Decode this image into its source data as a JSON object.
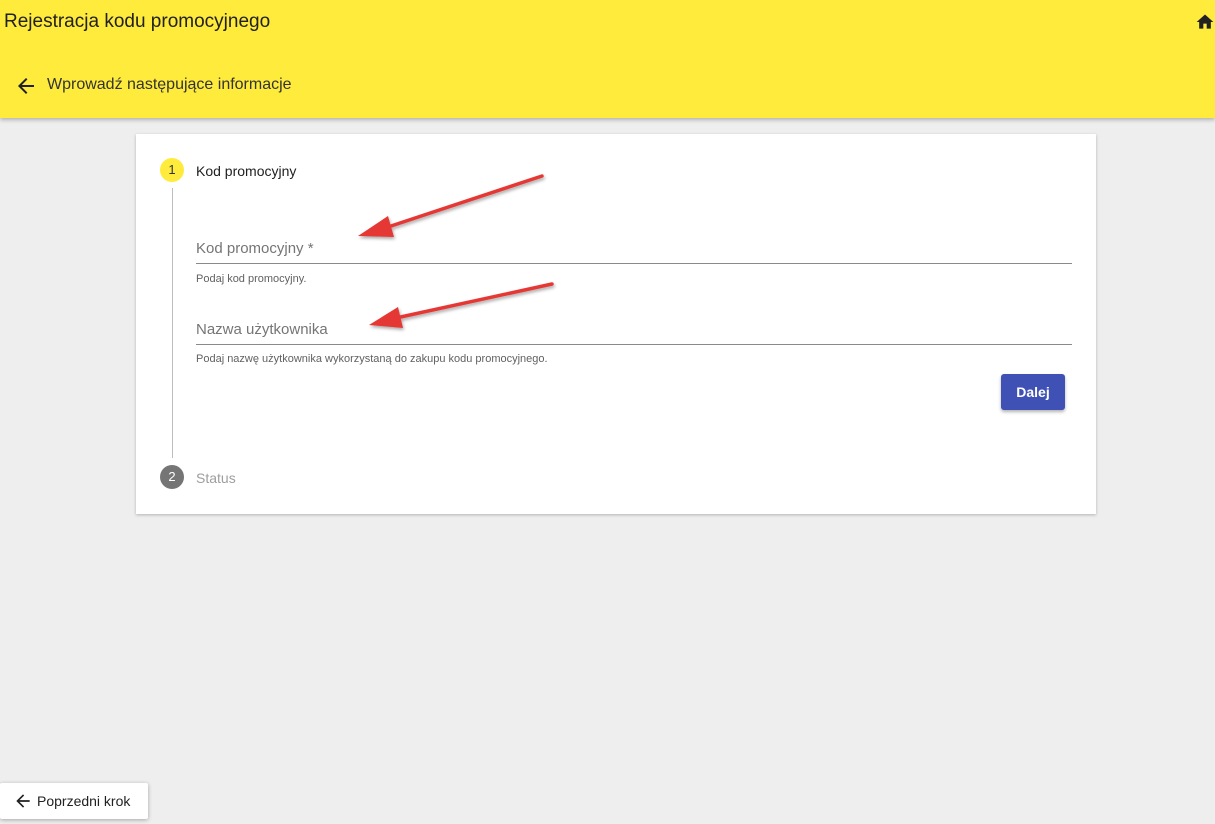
{
  "header": {
    "title": "Rejestracja kodu promocyjnego",
    "subtitle": "Wprowadź następujące informacje",
    "home_icon": "home-icon",
    "back_icon": "arrow-left-icon"
  },
  "stepper": {
    "steps": [
      {
        "number": "1",
        "label": "Kod promocyjny",
        "state": "active"
      },
      {
        "number": "2",
        "label": "Status",
        "state": "inactive"
      }
    ]
  },
  "form": {
    "promo_code": {
      "placeholder": "Kod promocyjny *",
      "value": "",
      "hint": "Podaj kod promocyjny."
    },
    "username": {
      "placeholder": "Nazwa użytkownika",
      "value": "",
      "hint": "Podaj nazwę użytkownika wykorzystaną do zakupu kodu promocyjnego."
    },
    "next_label": "Dalej"
  },
  "footer": {
    "prev_label": "Poprzedni krok",
    "prev_icon": "arrow-left-icon"
  },
  "colors": {
    "toolbar": "#ffeb3b",
    "primary_button": "#3f51b5",
    "annotation_arrow": "#e53935"
  }
}
